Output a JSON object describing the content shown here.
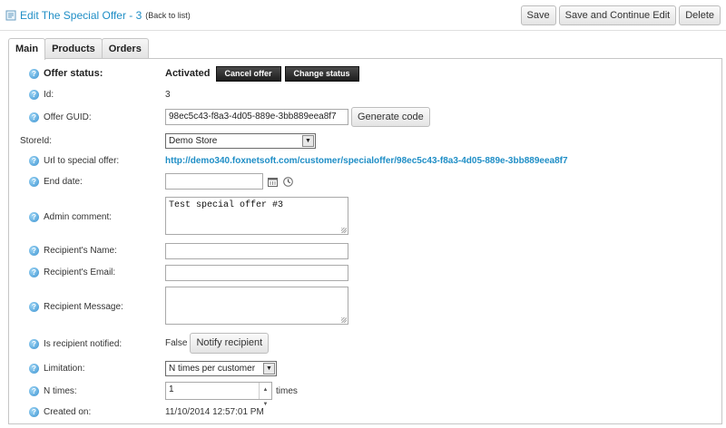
{
  "header": {
    "title": "Edit The Special Offer - 3",
    "back_link": "(Back to list)",
    "buttons": {
      "save": "Save",
      "save_continue": "Save and Continue Edit",
      "delete": "Delete"
    }
  },
  "tabs": [
    "Main",
    "Products",
    "Orders"
  ],
  "form": {
    "offer_status": {
      "label": "Offer status:",
      "value": "Activated",
      "cancel_btn": "Cancel offer",
      "change_btn": "Change status"
    },
    "id": {
      "label": "Id:",
      "value": "3"
    },
    "guid": {
      "label": "Offer GUID:",
      "value": "98ec5c43-f8a3-4d05-889e-3bb889eea8f7",
      "btn": "Generate code"
    },
    "store": {
      "label": "StoreId:",
      "value": "Demo Store"
    },
    "url": {
      "label": "Url to special offer:",
      "value": "http://demo340.foxnetsoft.com/customer/specialoffer/98ec5c43-f8a3-4d05-889e-3bb889eea8f7"
    },
    "end_date": {
      "label": "End date:",
      "value": ""
    },
    "admin_comment": {
      "label": "Admin comment:",
      "value": "Test special offer #3"
    },
    "recipient_name": {
      "label": "Recipient's Name:",
      "value": ""
    },
    "recipient_email": {
      "label": "Recipient's Email:",
      "value": ""
    },
    "recipient_message": {
      "label": "Recipient Message:",
      "value": ""
    },
    "notified": {
      "label": "Is recipient notified:",
      "value": "False",
      "btn": "Notify recipient"
    },
    "limitation": {
      "label": "Limitation:",
      "value": "N times per customer"
    },
    "n_times": {
      "label": "N times:",
      "value": "1",
      "suffix": "times"
    },
    "created_on": {
      "label": "Created on:",
      "value": "11/10/2014 12:57:01 PM"
    }
  },
  "icons": {
    "help": "help-icon",
    "calendar": "calendar-icon",
    "clock": "clock-icon"
  },
  "colors": {
    "accent": "#1f8ec6",
    "dark_button": "#2b2b2b"
  }
}
